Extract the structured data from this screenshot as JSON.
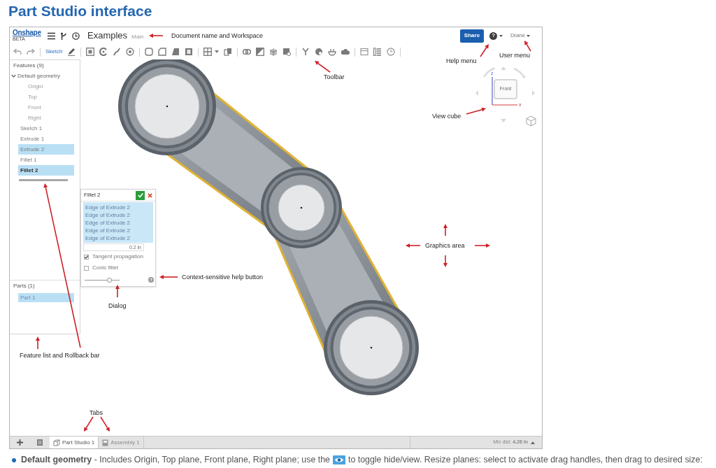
{
  "page_title": "Part Studio interface",
  "header": {
    "logo": "Onshape",
    "logo_badge": "BETA",
    "document_name": "Examples",
    "workspace": "Main",
    "share_button": "Share",
    "help_button": "?",
    "user_menu": "Diane"
  },
  "toolbar": {
    "sketch_button": "Sketch"
  },
  "features": {
    "title": "Features (9)",
    "items": [
      {
        "label": "Default geometry",
        "expanded": true,
        "hidden": false,
        "selected": false,
        "editing": false,
        "children": [
          {
            "label": "Origin",
            "hidden": true,
            "selected": false,
            "editing": false
          },
          {
            "label": "Top",
            "hidden": true,
            "selected": false,
            "editing": false
          },
          {
            "label": "Front",
            "hidden": true,
            "selected": false,
            "editing": false
          },
          {
            "label": "Right",
            "hidden": true,
            "selected": false,
            "editing": false
          }
        ]
      },
      {
        "label": "Sketch 1",
        "hidden": false,
        "selected": false,
        "editing": false
      },
      {
        "label": "Extrude 1",
        "hidden": false,
        "selected": false,
        "editing": false
      },
      {
        "label": "Extrude 2",
        "hidden": false,
        "selected": true,
        "editing": false
      },
      {
        "label": "Fillet 1",
        "hidden": false,
        "selected": false,
        "editing": false
      },
      {
        "label": "Fillet 2",
        "hidden": false,
        "selected": true,
        "editing": true
      }
    ]
  },
  "parts": {
    "title": "Parts (1)",
    "items": [
      {
        "label": "Part 1",
        "selected": true
      }
    ]
  },
  "dialog": {
    "title": "Fillet 2",
    "selections": [
      "Edge of Extrude 2",
      "Edge of Extrude 2",
      "Edge of Extrude 2",
      "Edge of Extrude 2",
      "Edge of Extrude 2"
    ],
    "radius": "0.2 in",
    "options": [
      {
        "label": "Tangent propagation",
        "checked": true
      },
      {
        "label": "Conic fillet",
        "checked": false
      }
    ],
    "slider": {
      "level": 0.7
    },
    "help_button": "?"
  },
  "view_cube": {
    "face": "Front",
    "z_label": "z",
    "x_label": "x"
  },
  "tabs": [
    {
      "label": "Part Studio 1",
      "kind": "part_studio",
      "selected": true
    },
    {
      "label": "Assembly 1",
      "kind": "assembly",
      "selected": false
    }
  ],
  "status_bar": {
    "min_dist": "Min dist: **4.26 in**"
  },
  "callouts": [
    {
      "label": "Document name and Workspace"
    },
    {
      "label": "User menu"
    },
    {
      "label": "Help menu"
    },
    {
      "label": "Toolbar"
    },
    {
      "label": "View cube"
    },
    {
      "label": "Graphics area"
    },
    {
      "label": "Context-sensitive help button"
    },
    {
      "label": "Dialog"
    },
    {
      "label": "Feature list and Rollback bar"
    },
    {
      "label": "Tabs"
    }
  ],
  "caption": {
    "before": "**Default geometry** - Includes Origin, Top plane, Front plane, Right plane; use the",
    "after": "to toggle hide/view. Resize planes: select to activate drag handles, then drag to desired size:"
  }
}
